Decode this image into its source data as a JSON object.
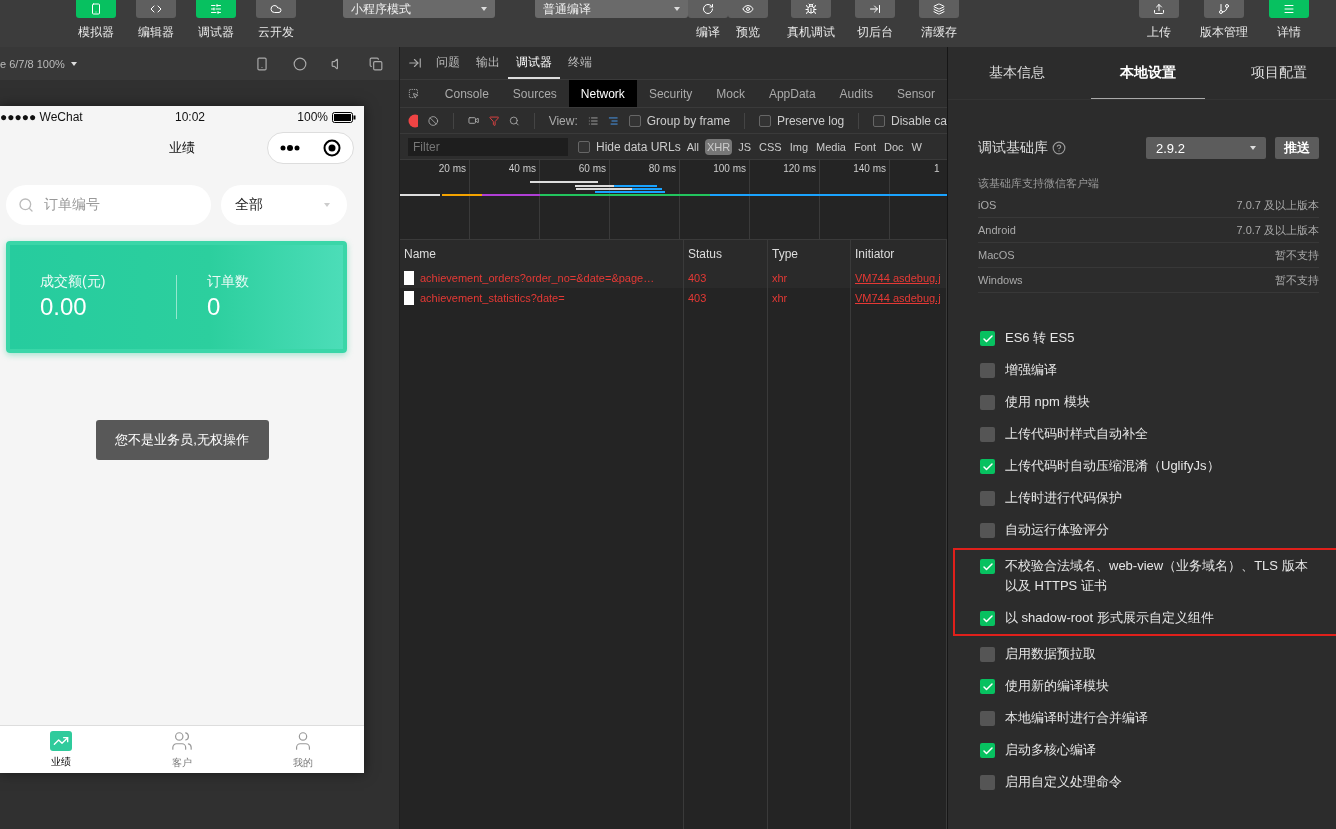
{
  "toolbar": {
    "views": [
      {
        "label": "模拟器",
        "selected": true
      },
      {
        "label": "编辑器",
        "selected": false
      },
      {
        "label": "调试器",
        "selected": true
      },
      {
        "label": "云开发",
        "selected": false
      }
    ],
    "mode_select": "小程序模式",
    "compile_select": "普通编译",
    "actions": [
      {
        "label": "编译"
      },
      {
        "label": "预览"
      },
      {
        "label": "真机调试"
      },
      {
        "label": "切后台"
      },
      {
        "label": "清缓存"
      }
    ],
    "right": [
      {
        "label": "上传",
        "selected": false
      },
      {
        "label": "版本管理",
        "selected": false
      },
      {
        "label": "详情",
        "selected": true
      }
    ]
  },
  "simulator": {
    "device": "e 6/7/8 100%",
    "status_bar": {
      "carrier": "●●●●● WeChat",
      "time": "10:02",
      "battery": "100%"
    },
    "nav_title": "业绩",
    "search": {
      "placeholder": "订单编号"
    },
    "filter": "全部",
    "stats": [
      {
        "label": "成交额(元)",
        "value": "0.00"
      },
      {
        "label": "订单数",
        "value": "0"
      }
    ],
    "toast": "您不是业务员,无权操作",
    "tabs": [
      {
        "label": "业绩",
        "selected": true
      },
      {
        "label": "客户",
        "selected": false
      },
      {
        "label": "我的",
        "selected": false
      }
    ]
  },
  "devtools": {
    "panels": [
      {
        "label": "问题",
        "selected": false
      },
      {
        "label": "输出",
        "selected": false
      },
      {
        "label": "调试器",
        "selected": true
      },
      {
        "label": "终端",
        "selected": false
      }
    ],
    "tabs": [
      {
        "label": "Console",
        "selected": false
      },
      {
        "label": "Sources",
        "selected": false
      },
      {
        "label": "Network",
        "selected": true
      },
      {
        "label": "Security",
        "selected": false
      },
      {
        "label": "Mock",
        "selected": false
      },
      {
        "label": "AppData",
        "selected": false
      },
      {
        "label": "Audits",
        "selected": false
      },
      {
        "label": "Sensor",
        "selected": false
      }
    ],
    "view_label": "View:",
    "options": [
      {
        "label": "Group by frame",
        "checked": false
      },
      {
        "label": "Preserve log",
        "checked": false
      },
      {
        "label": "Disable ca",
        "checked": false
      }
    ],
    "filter": {
      "placeholder": "Filter"
    },
    "hide_data_urls": {
      "label": "Hide data URLs",
      "checked": false
    },
    "types": [
      {
        "label": "All",
        "selected": false
      },
      {
        "label": "XHR",
        "selected": true
      },
      {
        "label": "JS",
        "selected": false
      },
      {
        "label": "CSS",
        "selected": false
      },
      {
        "label": "Img",
        "selected": false
      },
      {
        "label": "Media",
        "selected": false
      },
      {
        "label": "Font",
        "selected": false
      },
      {
        "label": "Doc",
        "selected": false
      },
      {
        "label": "W",
        "selected": false
      }
    ],
    "ticks": [
      "20 ms",
      "40 ms",
      "60 ms",
      "80 ms",
      "100 ms",
      "120 ms",
      "140 ms",
      "1"
    ],
    "table": {
      "columns": [
        "Name",
        "Status",
        "Type",
        "Initiator"
      ],
      "rows": [
        {
          "name": "achievement_orders?order_no=&date=&page…",
          "status": "403",
          "type": "xhr",
          "initiator": "VM744 asdebug.j"
        },
        {
          "name": "achievement_statistics?date=",
          "status": "403",
          "type": "xhr",
          "initiator": "VM744 asdebug.j"
        }
      ]
    }
  },
  "settings": {
    "tabs": [
      {
        "label": "基本信息",
        "selected": false
      },
      {
        "label": "本地设置",
        "selected": true
      },
      {
        "label": "项目配置",
        "selected": false
      }
    ],
    "library": {
      "label": "调试基础库",
      "version": "2.9.2",
      "push": "推送"
    },
    "support_title": "该基础库支持微信客户端",
    "support": [
      {
        "platform": "iOS",
        "value": "7.0.7 及以上版本"
      },
      {
        "platform": "Android",
        "value": "7.0.7 及以上版本"
      },
      {
        "platform": "MacOS",
        "value": "暂不支持"
      },
      {
        "platform": "Windows",
        "value": "暂不支持"
      }
    ],
    "option_groups": [
      {
        "highlighted": false,
        "options": [
          {
            "label": "ES6 转 ES5",
            "checked": true
          },
          {
            "label": "增强编译",
            "checked": false
          },
          {
            "label": "使用 npm 模块",
            "checked": false
          },
          {
            "label": "上传代码时样式自动补全",
            "checked": false
          },
          {
            "label": "上传代码时自动压缩混淆（UglifyJs）",
            "checked": true
          },
          {
            "label": "上传时进行代码保护",
            "checked": false
          },
          {
            "label": "自动运行体验评分",
            "checked": false
          }
        ]
      },
      {
        "highlighted": true,
        "options": [
          {
            "label": "不校验合法域名、web-view（业务域名）、TLS 版本以及 HTTPS 证书",
            "checked": true
          },
          {
            "label": "以 shadow-root 形式展示自定义组件",
            "checked": true
          }
        ]
      },
      {
        "highlighted": false,
        "options": [
          {
            "label": "启用数据预拉取",
            "checked": false
          },
          {
            "label": "使用新的编译模块",
            "checked": true
          },
          {
            "label": "本地编译时进行合并编译",
            "checked": false
          },
          {
            "label": "启动多核心编译",
            "checked": true
          },
          {
            "label": "启用自定义处理命令",
            "checked": false
          }
        ]
      }
    ]
  }
}
